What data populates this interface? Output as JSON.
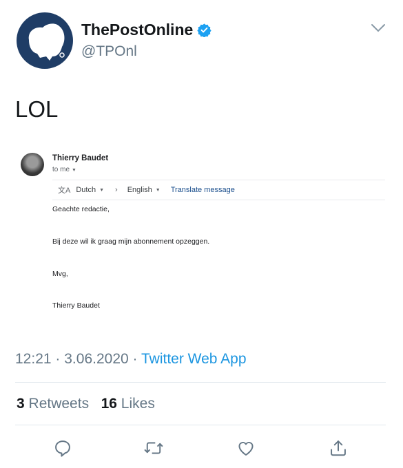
{
  "profile": {
    "name": "ThePostOnline",
    "handle": "@TPOnl",
    "verified_icon": "verified-badge-icon",
    "avatar_color": "#1f3d66"
  },
  "tweet": {
    "text": "LOL",
    "time": "12:21",
    "separator": "·",
    "date": "3.06.2020",
    "source": "Twitter Web App"
  },
  "email": {
    "sender": "Thierry Baudet",
    "recipient_label": "to me",
    "translate": {
      "from_lang": "Dutch",
      "to_lang": "English",
      "link": "Translate message"
    },
    "body": [
      "Geachte redactie,",
      "Bij deze wil ik graag mijn abonnement opzeggen.",
      "Mvg,",
      "Thierry Baudet"
    ]
  },
  "stats": {
    "retweets_count": "3",
    "retweets_label": "Retweets",
    "likes_count": "16",
    "likes_label": "Likes"
  },
  "actions": [
    "reply-icon",
    "retweet-icon",
    "like-icon",
    "share-icon"
  ],
  "colors": {
    "link": "#1b95e0",
    "muted": "#657786",
    "text": "#14171a"
  }
}
